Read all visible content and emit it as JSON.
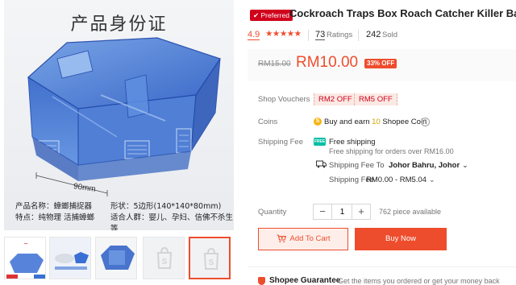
{
  "gallery": {
    "main_image": {
      "title": "产品身份证",
      "dimension_label": "90mm",
      "specs": {
        "name": "产品名称：蟑螂捕捉器",
        "shape": "形状：5边形(140*140*80mm)",
        "features": "特点：纯物理 活捕蟑螂",
        "audience": "适合人群：婴儿、孕妇、信佛不杀生等"
      }
    },
    "thumbnails": [
      {
        "label": "thumbnail-1"
      },
      {
        "label": "thumbnail-2"
      },
      {
        "label": "thumbnail-3"
      },
      {
        "label": "thumbnail-4"
      },
      {
        "label": "thumbnail-5"
      }
    ]
  },
  "product": {
    "preferred_badge": "Preferred",
    "title": "Cockroach Traps Box Roach Catcher Killer Bait",
    "rating": "4.9",
    "stars": "★★★★★",
    "ratings_count": "73",
    "ratings_label": "Ratings",
    "sold_count": "242",
    "sold_label": "Sold"
  },
  "price": {
    "original": "RM15.00",
    "current": "RM10.00",
    "discount": "33% OFF"
  },
  "vouchers": {
    "label": "Shop Vouchers",
    "items": [
      "RM2 OFF",
      "RM5 OFF"
    ]
  },
  "coins": {
    "label": "Coins",
    "text_before": "Buy and earn ",
    "amount": "10",
    "text_after": " Shopee Coin"
  },
  "shipping": {
    "label": "Shipping Fee",
    "free_title": "Free shipping",
    "free_sub": "Free shipping for orders over RM16.00",
    "ship_to_label": "Shipping Fee To",
    "ship_to_value": "Johor Bahru, Johor",
    "fee_label": "Shipping Fee",
    "fee_value": "RM0.00 - RM5.04"
  },
  "quantity": {
    "label": "Quantity",
    "value": "1",
    "stock": "762 piece available"
  },
  "actions": {
    "add_to_cart": "Add To Cart",
    "buy_now": "Buy Now"
  },
  "guarantee": {
    "title": "Shopee Guarantee",
    "desc": "Get the items you ordered or get your money back"
  },
  "colors": {
    "accent": "#ee4d2d",
    "preferred": "#d0011b",
    "teal": "#00bfa5"
  }
}
